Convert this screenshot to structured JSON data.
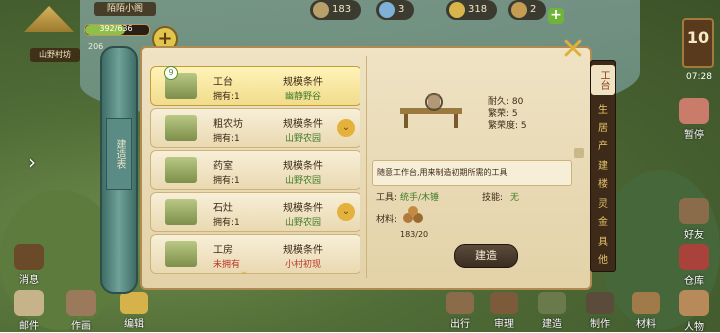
{
  "hud": {
    "village_name": "陌陌小阁",
    "sub_name": "山野村坊",
    "population": "392/636",
    "coins_small": "206",
    "res1": "183",
    "res2": "3",
    "res3": "318",
    "res4": "2",
    "day": "10",
    "time": "07:28"
  },
  "right_menu": [
    "暂停",
    "好友",
    "仓库",
    "人物"
  ],
  "left_menu": [
    "消息",
    "邮件",
    "作画"
  ],
  "bottom_menu": [
    "编辑",
    "出行",
    "审理",
    "建造",
    "制作",
    "材料"
  ],
  "panel": {
    "vertical_title": "建造表",
    "items": [
      {
        "name": "工台",
        "owned": "拥有:1",
        "cond_label": "规模条件",
        "cond": "幽静野谷",
        "cond_red": false,
        "own_red": false
      },
      {
        "name": "粗农坊",
        "owned": "拥有:1",
        "cond_label": "规模条件",
        "cond": "山野农园",
        "cond_red": false,
        "own_red": false
      },
      {
        "name": "药室",
        "owned": "拥有:1",
        "cond_label": "规模条件",
        "cond": "山野农园",
        "cond_red": false,
        "own_red": false
      },
      {
        "name": "石灶",
        "owned": "拥有:1",
        "cond_label": "规模条件",
        "cond": "山野农园",
        "cond_red": false,
        "own_red": false
      },
      {
        "name": "工房",
        "owned": "未拥有",
        "cond_label": "规模条件",
        "cond": "小村初现",
        "cond_red": true,
        "own_red": true
      }
    ],
    "badge": "9",
    "detail": {
      "durability": "耐久: 80",
      "prosperity": "繁荣: 5",
      "prosperity2": "繁荣度: 5",
      "desc": "随意工作台,用来制造初期所需的工具",
      "tool_label": "工具:",
      "tool_value": "统手/木锤",
      "skill_label": "技能:",
      "skill_value": "无",
      "material_label": "材料:",
      "material_count": "183/20",
      "build_button": "建造"
    },
    "tabs": [
      "工台",
      "生",
      "居",
      "产",
      "建",
      "楼",
      "灵",
      "金",
      "具",
      "他"
    ]
  }
}
